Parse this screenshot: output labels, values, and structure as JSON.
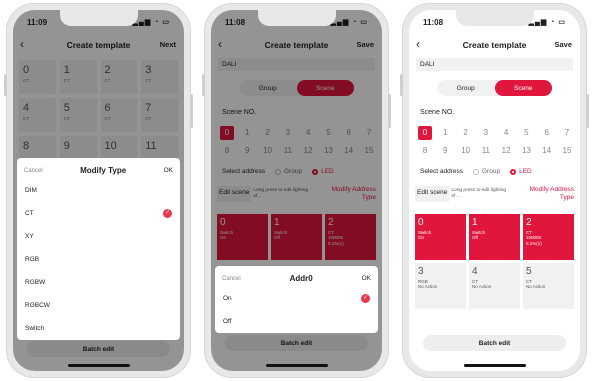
{
  "colors": {
    "accent": "#e0163c",
    "overlay": "rgba(0,0,0,0.42)"
  },
  "phone1": {
    "time": "11:09",
    "title": "Create template",
    "next": "Next",
    "cells": [
      {
        "n": "0",
        "t": "CT"
      },
      {
        "n": "1",
        "t": "CT"
      },
      {
        "n": "2",
        "t": "CT"
      },
      {
        "n": "3",
        "t": "CT"
      },
      {
        "n": "4",
        "t": "CT"
      },
      {
        "n": "5",
        "t": "CT"
      },
      {
        "n": "6",
        "t": "CT"
      },
      {
        "n": "7",
        "t": "CT"
      },
      {
        "n": "8",
        "t": ""
      },
      {
        "n": "9",
        "t": ""
      },
      {
        "n": "10",
        "t": ""
      },
      {
        "n": "11",
        "t": ""
      }
    ],
    "sheet": {
      "cancel": "Cancel",
      "title": "Modify Type",
      "ok": "OK",
      "options": [
        "DIM",
        "CT",
        "XY",
        "RGB",
        "RGBW",
        "RGBCW",
        "Switch"
      ],
      "selected": "CT"
    },
    "batch": "Batch edit"
  },
  "phone2": {
    "time": "11:08",
    "title": "Create template",
    "save": "Save",
    "dali": "DALI",
    "seg": {
      "group": "Group",
      "scene": "Scene"
    },
    "scene_label": "Scene NO.",
    "scene_row1": [
      "0",
      "1",
      "2",
      "3",
      "4",
      "5",
      "6",
      "7"
    ],
    "scene_row2": [
      "8",
      "9",
      "10",
      "11",
      "12",
      "13",
      "14",
      "15"
    ],
    "select_address": "Select address",
    "radio_group": "Group",
    "radio_led": "LED",
    "edit_scene": "Edit scene",
    "hint": "Long press to edit lighting ef...",
    "modify": "Modify Address Type",
    "cards": [
      {
        "n": "0",
        "t": "Switch",
        "s1": "On",
        "s2": ""
      },
      {
        "n": "1",
        "t": "Switch",
        "s1": "Off",
        "s2": ""
      },
      {
        "n": "2",
        "t": "CT",
        "s1": "10000K",
        "s2": "0.1%(1)"
      }
    ],
    "sheet": {
      "cancel": "Cancel",
      "title": "Addr0",
      "ok": "OK",
      "options": [
        "On",
        "Off"
      ],
      "selected": "On"
    },
    "batch": "Batch edit"
  },
  "phone3": {
    "time": "11:08",
    "title": "Create template",
    "save": "Save",
    "dali": "DALI",
    "seg": {
      "group": "Group",
      "scene": "Scene"
    },
    "scene_label": "Scene NO.",
    "scene_row1": [
      "0",
      "1",
      "2",
      "3",
      "4",
      "5",
      "6",
      "7"
    ],
    "scene_row2": [
      "8",
      "9",
      "10",
      "11",
      "12",
      "13",
      "14",
      "15"
    ],
    "select_address": "Select address",
    "radio_group": "Group",
    "radio_led": "LED",
    "edit_scene": "Edit scene",
    "hint": "Long press to edit lighting ef...",
    "modify": "Modify Address Type",
    "cards": [
      {
        "n": "0",
        "t": "Switch",
        "s1": "On",
        "s2": ""
      },
      {
        "n": "1",
        "t": "Switch",
        "s1": "Off",
        "s2": ""
      },
      {
        "n": "2",
        "t": "CT",
        "s1": "10000K",
        "s2": "0.1%(1)"
      },
      {
        "n": "3",
        "t": "RGB",
        "s1": "No Action",
        "s2": ""
      },
      {
        "n": "4",
        "t": "CT",
        "s1": "No Action",
        "s2": ""
      },
      {
        "n": "5",
        "t": "CT",
        "s1": "No Action",
        "s2": ""
      }
    ],
    "batch": "Batch edit"
  }
}
